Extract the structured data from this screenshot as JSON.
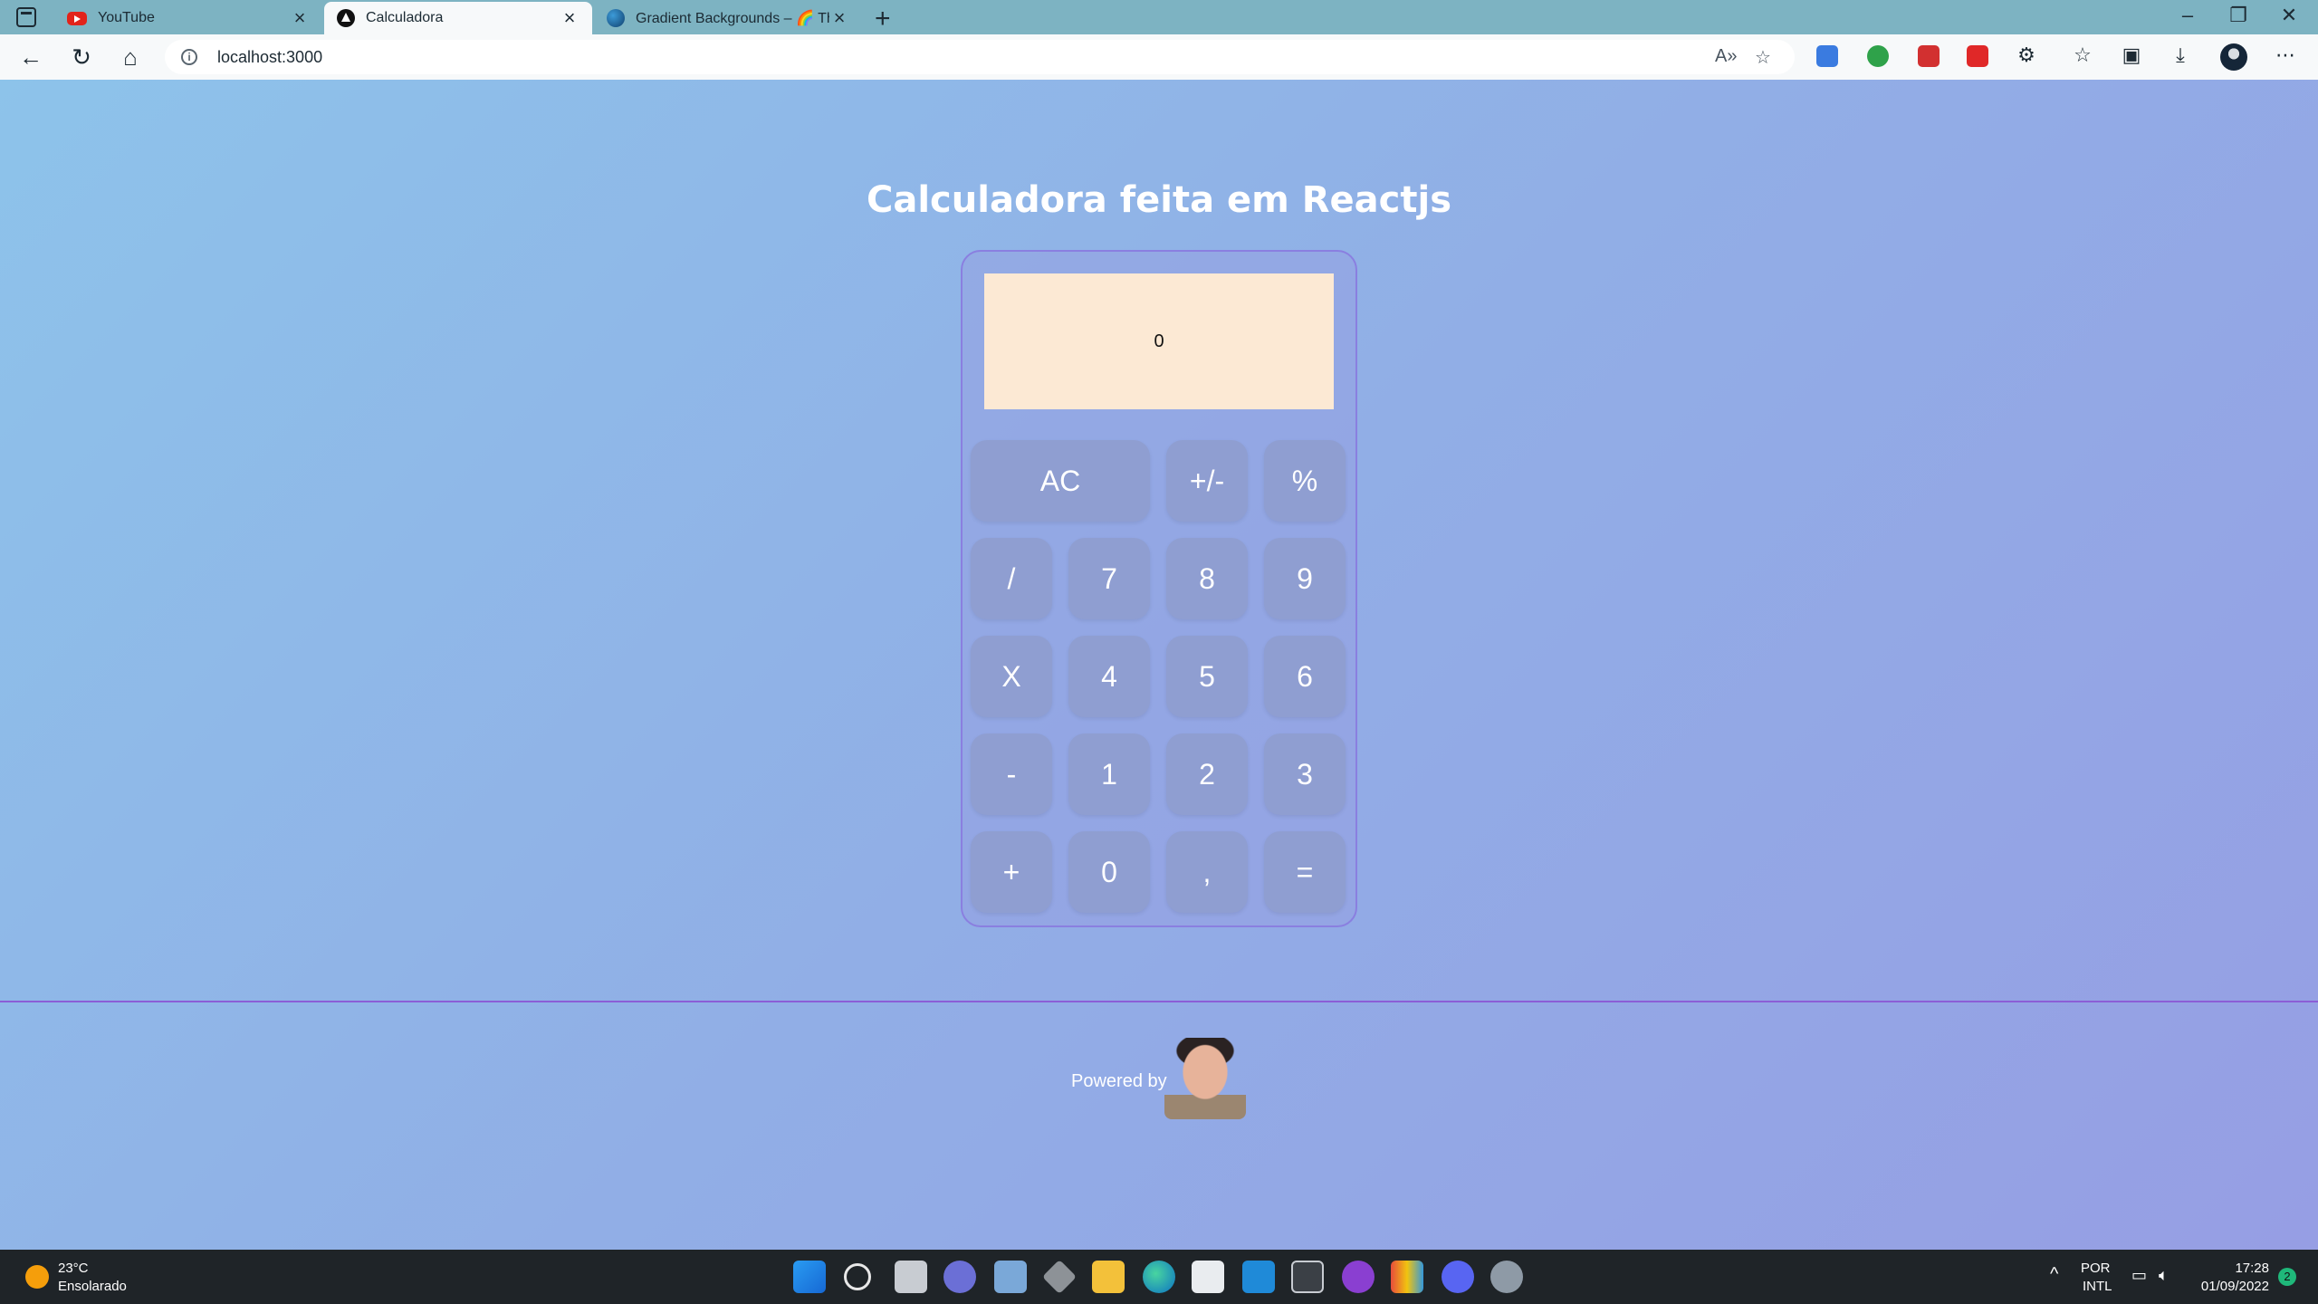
{
  "browser": {
    "tabs": [
      {
        "title": "YouTube"
      },
      {
        "title": "Calculadora"
      },
      {
        "title": "Gradient Backgrounds – 🌈 The"
      }
    ],
    "url": "localhost:3000"
  },
  "page": {
    "heading": "Calculadora feita em Reactjs",
    "display_value": "0",
    "keys": [
      [
        "AC",
        "+/-",
        "%"
      ],
      [
        "/",
        "7",
        "8",
        "9"
      ],
      [
        "X",
        "4",
        "5",
        "6"
      ],
      [
        "-",
        "1",
        "2",
        "3"
      ],
      [
        "+",
        "0",
        ",",
        "="
      ]
    ],
    "footer": {
      "powered_by": "Powered by"
    }
  },
  "taskbar": {
    "weather": {
      "temp": "23°C",
      "condition": "Ensolarado"
    },
    "language": {
      "line1": "POR",
      "line2": "INTL"
    },
    "clock": {
      "time": "17:28",
      "date": "01/09/2022"
    },
    "notifications": "2",
    "apps": [
      "start",
      "search",
      "task-view",
      "chat",
      "photos",
      "unity",
      "file-explorer",
      "edge",
      "store",
      "vscode",
      "terminal",
      "github-desktop",
      "app",
      "discord",
      "settings"
    ]
  },
  "colors": {
    "display_bg": "#fce9d4",
    "key_bg": "#8f9ed1",
    "divider": "#8b5ed6",
    "taskbar": "#1f2428"
  }
}
